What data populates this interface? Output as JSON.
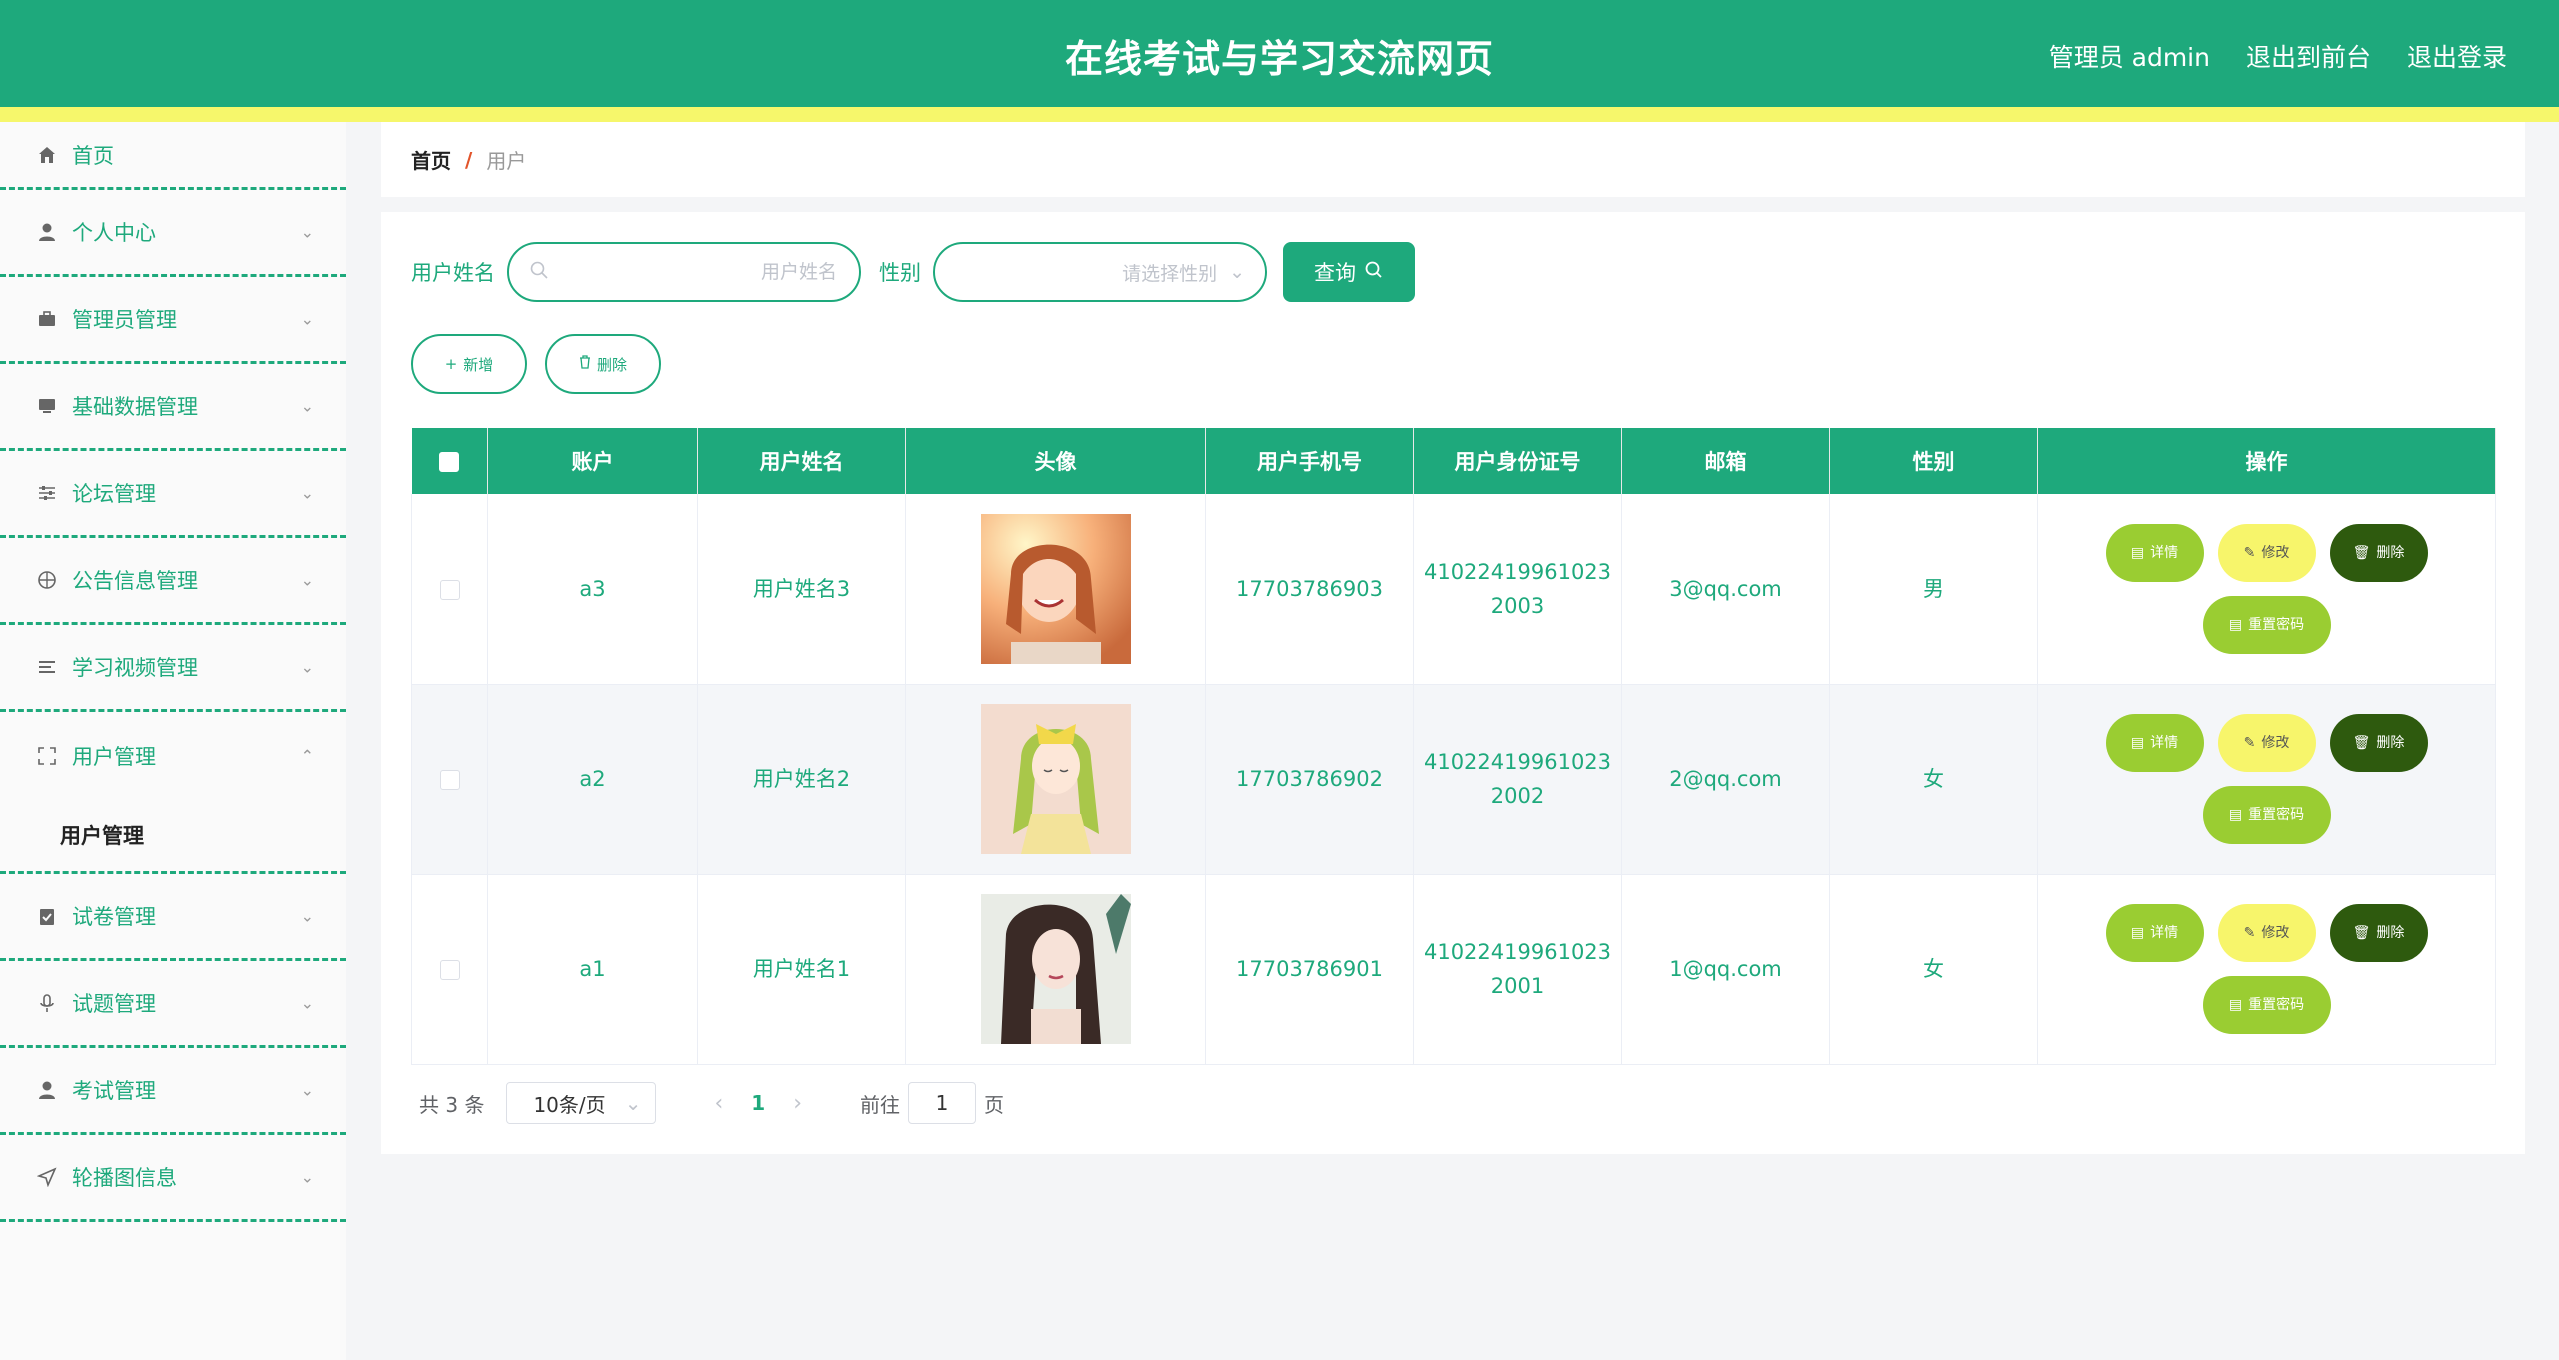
{
  "header": {
    "title": "在线考试与学习交流网页",
    "user_label": "管理员 admin",
    "front_link": "退出到前台",
    "logout_link": "退出登录"
  },
  "sidebar": {
    "items": [
      {
        "label": "首页",
        "icon": "home-icon"
      },
      {
        "label": "个人中心",
        "icon": "user-icon"
      },
      {
        "label": "管理员管理",
        "icon": "briefcase-icon"
      },
      {
        "label": "基础数据管理",
        "icon": "monitor-icon"
      },
      {
        "label": "论坛管理",
        "icon": "sliders-icon"
      },
      {
        "label": "公告信息管理",
        "icon": "globe-icon"
      },
      {
        "label": "学习视频管理",
        "icon": "list-icon"
      },
      {
        "label": "用户管理",
        "icon": "fullscreen-icon"
      },
      {
        "label": "试卷管理",
        "icon": "clipboard-icon"
      },
      {
        "label": "试题管理",
        "icon": "microphone-icon"
      },
      {
        "label": "考试管理",
        "icon": "user-icon"
      },
      {
        "label": "轮播图信息",
        "icon": "navigation-icon"
      }
    ],
    "submenu_active": "用户管理"
  },
  "breadcrumb": {
    "home": "首页",
    "separator": "/",
    "current": "用户"
  },
  "search": {
    "name_label": "用户姓名",
    "name_placeholder": "用户姓名",
    "gender_label": "性别",
    "gender_placeholder": "请选择性别",
    "query_button": "查询"
  },
  "actions": {
    "add": "新增",
    "delete": "删除"
  },
  "table": {
    "headers": [
      "账户",
      "用户姓名",
      "头像",
      "用户手机号",
      "用户身份证号",
      "邮箱",
      "性别",
      "操作"
    ],
    "rows": [
      {
        "account": "a3",
        "name": "用户姓名3",
        "phone": "17703786903",
        "id_line1": "41022419961023",
        "id_line2": "2003",
        "email": "3@qq.com",
        "gender": "男"
      },
      {
        "account": "a2",
        "name": "用户姓名2",
        "phone": "17703786902",
        "id_line1": "41022419961023",
        "id_line2": "2002",
        "email": "2@qq.com",
        "gender": "女"
      },
      {
        "account": "a1",
        "name": "用户姓名1",
        "phone": "17703786901",
        "id_line1": "41022419961023",
        "id_line2": "2001",
        "email": "1@qq.com",
        "gender": "女"
      }
    ],
    "row_actions": {
      "detail": "详情",
      "edit": "修改",
      "delete": "删除",
      "reset": "重置密码"
    }
  },
  "pagination": {
    "total": "共 3 条",
    "page_size": "10条/页",
    "current_page": "1",
    "jump_label": "前往",
    "jump_value": "1",
    "jump_unit": "页"
  },
  "colors": {
    "primary": "#1ea97c",
    "accent_yellow": "#f6f76b",
    "yellowgreen": "#9acd32",
    "dark_green": "#2e5a0e"
  }
}
